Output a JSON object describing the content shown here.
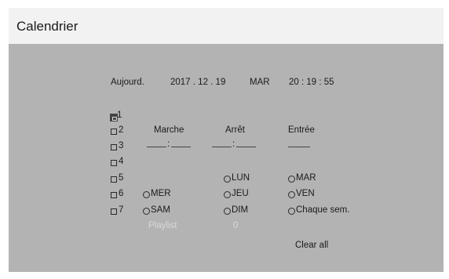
{
  "title": "Calendrier",
  "today": {
    "label": "Aujourd.",
    "date": "2017 . 12 . 19",
    "day": "MAR",
    "time": "20 : 19 : 55"
  },
  "columns": {
    "start": "Marche",
    "stop": "Arrêt",
    "input": "Entrée"
  },
  "time_separator": ":",
  "schedules": [
    "1",
    "2",
    "3",
    "4",
    "5",
    "6",
    "7"
  ],
  "days": {
    "mon": "LUN",
    "tue": "MAR",
    "wed": "MER",
    "thu": "JEU",
    "fri": "VEN",
    "sat": "SAM",
    "sun": "DIM",
    "weekly": "Chaque sem."
  },
  "playlist": {
    "label": "Playlist",
    "value": "0"
  },
  "clear_all": "Clear all"
}
